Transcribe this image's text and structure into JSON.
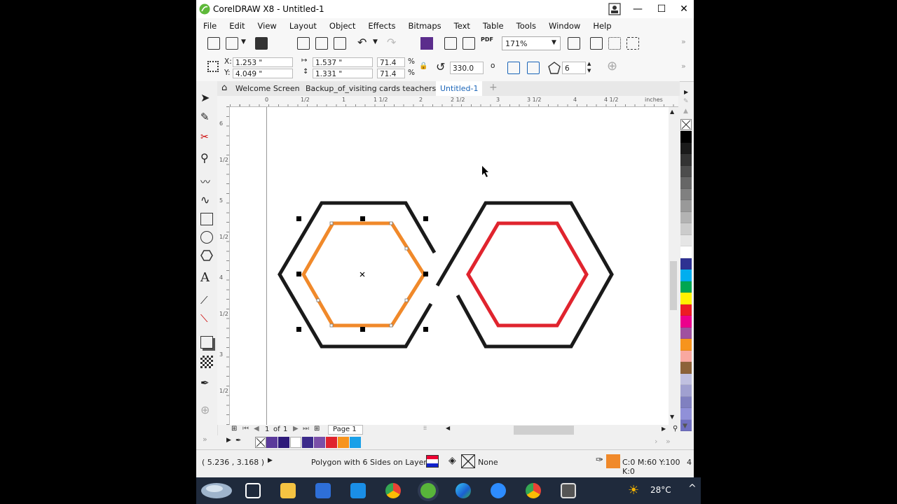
{
  "window": {
    "title": "CorelDRAW X8 - Untitled-1",
    "minimize": "—",
    "maximize": "☐",
    "close": "✕"
  },
  "menu": [
    "File",
    "Edit",
    "View",
    "Layout",
    "Object",
    "Effects",
    "Bitmaps",
    "Text",
    "Table",
    "Tools",
    "Window",
    "Help"
  ],
  "toolbar": {
    "zoom_value": "171%",
    "pdf_label": "PDF"
  },
  "properties": {
    "x_label": "X:",
    "x_value": "1.253 \"",
    "y_label": "Y:",
    "y_value": "4.049 \"",
    "width_value": "1.537 \"",
    "height_value": "1.331 \"",
    "scale_x": "71.4",
    "scale_y": "71.4",
    "percent": "%",
    "rotation": "330.0",
    "degree": "o",
    "sides": "6"
  },
  "tabs": [
    "Welcome Screen",
    "Backup_of_visiting cards teachers.cdr",
    "Untitled-1"
  ],
  "ruler": {
    "h_labels": [
      "0",
      "1/2",
      "1",
      "1 1/2",
      "2",
      "2 1/2",
      "3",
      "3 1/2",
      "4",
      "4 1/2",
      "inches"
    ],
    "v_labels": [
      "6",
      "1/2",
      "5",
      "1/2",
      "4",
      "1/2",
      "3",
      "1/2"
    ]
  },
  "page_nav": {
    "current": "1",
    "of": "of",
    "total": "1",
    "page_tab": "Page 1"
  },
  "status": {
    "coords": "( 5.236 , 3.168 )",
    "object_info": "Polygon with 6 Sides on Layer 1",
    "fill_none": "None",
    "outline_color": "C:0 M:60 Y:100 K:0",
    "outline_width": "4"
  },
  "colors": {
    "orange": "#f0892a",
    "red": "#e0242e",
    "black": "#1a1a1a",
    "accent": "#1a64b8"
  },
  "palette": [
    "#000000",
    "#1a1a1a",
    "#333333",
    "#4d4d4d",
    "#666666",
    "#808080",
    "#999999",
    "#b3b3b3",
    "#cccccc",
    "#e6e6e6",
    "#ffffff",
    "#2e3192",
    "#00aeef",
    "#00a651",
    "#fff200",
    "#ed1c24",
    "#ec008c",
    "#a0519f",
    "#f7941d",
    "#f9a8a0",
    "#8c6239",
    "#c0c0e0",
    "#a0a0d0",
    "#8080c0",
    "#9090d8",
    "#7070c0"
  ],
  "doc_palette": [
    "#5b3a9b",
    "#2e1a7a",
    "#ffffff",
    "#3b2a8a",
    "#7a4fa8",
    "#e0242e",
    "#f7941d",
    "#1aa0e8"
  ],
  "taskbar": {
    "weather": "28°C"
  }
}
